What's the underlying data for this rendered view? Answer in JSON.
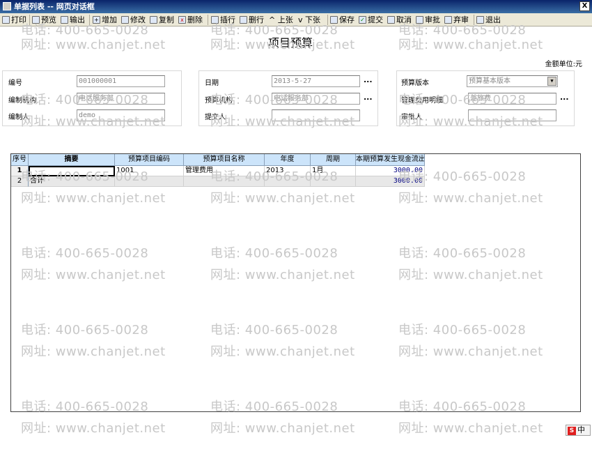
{
  "window": {
    "title": "单据列表 -- 网页对话框",
    "close_label": "X"
  },
  "toolbar": {
    "print": "打印",
    "preview": "预览",
    "export": "输出",
    "add": "增加",
    "modify": "修改",
    "copy": "复制",
    "delete": "删除",
    "insert_row": "插行",
    "delete_row": "删行",
    "prev": "上张",
    "next": "下张",
    "save": "保存",
    "submit": "提交",
    "cancel": "取消",
    "approve": "审批",
    "reject": "弃审",
    "exit": "退出"
  },
  "page": {
    "title": "项目预算",
    "unit": "金额单位:元"
  },
  "form": {
    "doc_no_label": "编号",
    "doc_no": "001000001",
    "org_label": "编制机构",
    "org": "电话服务部",
    "preparer_label": "编制人",
    "preparer": "demo",
    "date_label": "日期",
    "date": "2013-5-27",
    "budget_org_label": "预算机构",
    "budget_org": "电话服务部",
    "submitter_label": "提交人",
    "submitter": "",
    "version_label": "预算版本",
    "version": "预算基本版本",
    "detail_label": "管理费用明细",
    "detail": "差旅费",
    "approver_label": "审批人",
    "approver": "",
    "ellipsis": "..."
  },
  "grid": {
    "headers": [
      "序号",
      "摘要",
      "预算项目编码",
      "预算项目名称",
      "年度",
      "周期",
      "本期预算发生现金流出"
    ],
    "rows": [
      {
        "no": "1",
        "summary": "",
        "code": "1001",
        "name": "管理费用",
        "year": "2013",
        "period": "1月",
        "amount": "3000.00"
      },
      {
        "no": "2",
        "summary": "合计",
        "code": "",
        "name": "",
        "year": "",
        "period": "",
        "amount": "3000.00"
      }
    ]
  },
  "watermark": {
    "phone": "电话: 400-665-0028",
    "site": "网址: www.chanjet.net"
  },
  "ime": {
    "logo": "S",
    "label": "中"
  }
}
